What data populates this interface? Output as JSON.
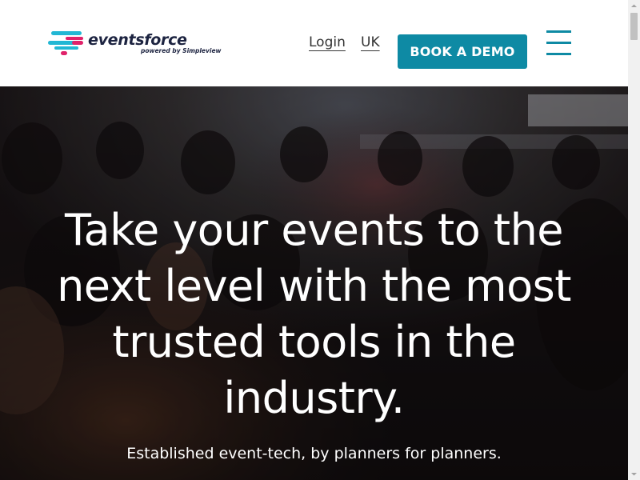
{
  "brand": {
    "name": "eventsforce",
    "tagline": "powered by Simpleview",
    "colors": {
      "primary": "#0e8aa4",
      "accent_pink": "#e0226a",
      "accent_cyan": "#22b7d4",
      "navy": "#1c2340"
    }
  },
  "nav": {
    "login_label": "Login",
    "region_label": "UK",
    "demo_label": "BOOK A DEMO",
    "menu_icon": "hamburger-menu-icon"
  },
  "hero": {
    "title": "Take your events to the next level with the most trusted tools in the industry.",
    "subtitle": "Established event-tech, by planners for planners.",
    "background": "conference audience photo"
  }
}
